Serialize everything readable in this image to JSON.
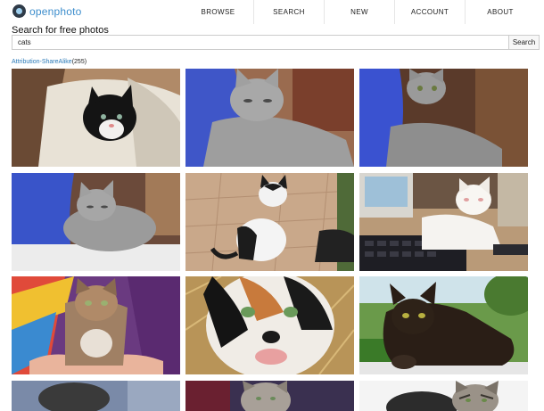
{
  "brand": {
    "name": "openphoto"
  },
  "nav": {
    "items": [
      {
        "label": "BROWSE"
      },
      {
        "label": "SEARCH"
      },
      {
        "label": "NEW"
      },
      {
        "label": "ACCOUNT"
      },
      {
        "label": "ABOUT"
      }
    ]
  },
  "search": {
    "title": "Search for free photos",
    "value": "cats",
    "button_label": "Search"
  },
  "license": {
    "name": "Attribution-ShareAlike",
    "count": "(255)"
  },
  "colors": {
    "link": "#2a7ab8",
    "brand": "#3c8dcc"
  },
  "photos": [
    {
      "subject": "black-and-white kitten on blanket"
    },
    {
      "subject": "grey cat on blue shirt"
    },
    {
      "subject": "grey cat on blue pillow"
    },
    {
      "subject": "grey cat lying on blue cloth"
    },
    {
      "subject": "black-and-white cat on pavement"
    },
    {
      "subject": "white cat on keyboard"
    },
    {
      "subject": "tabby kitten held in hands"
    },
    {
      "subject": "calico cat close-up"
    },
    {
      "subject": "black cat in grass"
    },
    {
      "subject": "cat photo"
    },
    {
      "subject": "kitten photo"
    },
    {
      "subject": "tabby cat photo"
    }
  ]
}
